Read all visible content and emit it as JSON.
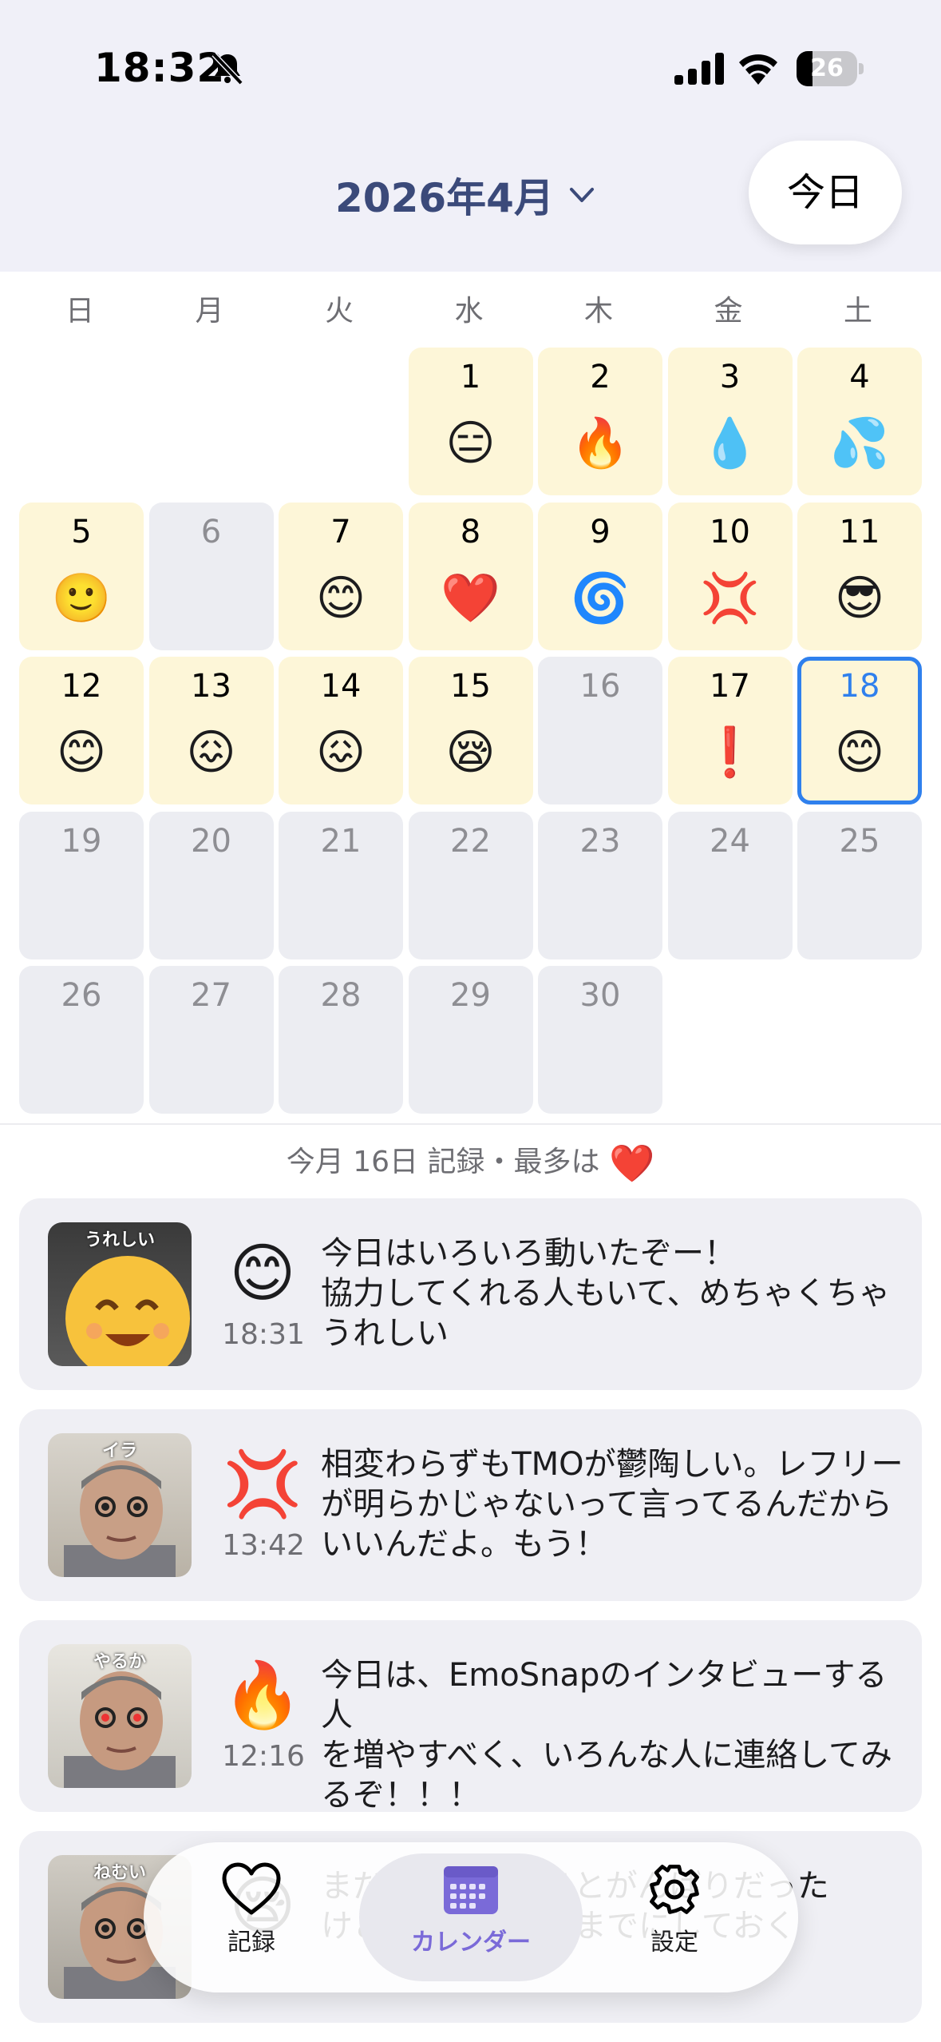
{
  "status_bar": {
    "time": "18:32",
    "battery_level": "26",
    "battery_fraction": 0.26
  },
  "header": {
    "month_title": "2026年4月",
    "today_button": "今日"
  },
  "calendar": {
    "weekdays": [
      "日",
      "月",
      "火",
      "水",
      "木",
      "金",
      "土"
    ],
    "first_weekday_index": 3,
    "today": 18,
    "days": [
      {
        "day": "1",
        "emoji": "😑",
        "recorded": true
      },
      {
        "day": "2",
        "emoji": "🔥",
        "recorded": true
      },
      {
        "day": "3",
        "emoji": "💧",
        "recorded": true
      },
      {
        "day": "4",
        "emoji": "💦",
        "recorded": true
      },
      {
        "day": "5",
        "emoji": "🙂",
        "recorded": true
      },
      {
        "day": "6",
        "emoji": "",
        "recorded": false
      },
      {
        "day": "7",
        "emoji": "😊",
        "recorded": true
      },
      {
        "day": "8",
        "emoji": "❤️",
        "recorded": true
      },
      {
        "day": "9",
        "emoji": "🌀",
        "recorded": true
      },
      {
        "day": "10",
        "emoji": "💢",
        "recorded": true
      },
      {
        "day": "11",
        "emoji": "😎",
        "recorded": true
      },
      {
        "day": "12",
        "emoji": "😊",
        "recorded": true
      },
      {
        "day": "13",
        "emoji": "😖",
        "recorded": true
      },
      {
        "day": "14",
        "emoji": "😖",
        "recorded": true
      },
      {
        "day": "15",
        "emoji": "😪",
        "recorded": true
      },
      {
        "day": "16",
        "emoji": "",
        "recorded": false
      },
      {
        "day": "17",
        "emoji": "❗",
        "recorded": true
      },
      {
        "day": "18",
        "emoji": "😊",
        "recorded": true
      },
      {
        "day": "19",
        "emoji": "",
        "recorded": false
      },
      {
        "day": "20",
        "emoji": "",
        "recorded": false
      },
      {
        "day": "21",
        "emoji": "",
        "recorded": false
      },
      {
        "day": "22",
        "emoji": "",
        "recorded": false
      },
      {
        "day": "23",
        "emoji": "",
        "recorded": false
      },
      {
        "day": "24",
        "emoji": "",
        "recorded": false
      },
      {
        "day": "25",
        "emoji": "",
        "recorded": false
      },
      {
        "day": "26",
        "emoji": "",
        "recorded": false
      },
      {
        "day": "27",
        "emoji": "",
        "recorded": false
      },
      {
        "day": "28",
        "emoji": "",
        "recorded": false
      },
      {
        "day": "29",
        "emoji": "",
        "recorded": false
      },
      {
        "day": "30",
        "emoji": "",
        "recorded": false
      }
    ]
  },
  "summary": {
    "text": "今月 16日 記録・最多は",
    "top_emoji": "❤️"
  },
  "entries": [
    {
      "emoji": "😊",
      "time": "18:31",
      "photo_caption": "うれしい",
      "text": "今日はいろいろ動いたぞー！\n協力してくれる人もいて、めちゃくちゃ\nうれしい"
    },
    {
      "emoji": "💢",
      "time": "13:42",
      "photo_caption": "イラ",
      "text": "相変わらずもTMOが鬱陶しい。レフリー\nが明らかじゃないって言ってるんだから\nいいんだよ。もう！"
    },
    {
      "emoji": "🔥",
      "time": "12:16",
      "photo_caption": "やるか",
      "text": "今日は、EmoSnapのインタビューする人\nを増やすべく、いろんな人に連絡してみ\nるぞ！！！"
    },
    {
      "emoji": "😪",
      "time": "",
      "photo_caption": "ねむい",
      "text": "まだまだ…もうひとがんばりだった\nけど、今日はここまでにしておく"
    }
  ],
  "tabbar": {
    "tabs": [
      {
        "label": "記録",
        "icon": "heart-icon"
      },
      {
        "label": "カレンダー",
        "icon": "calendar-icon"
      },
      {
        "label": "設定",
        "icon": "gear-icon"
      }
    ],
    "active_index": 1
  },
  "colors": {
    "header_bg": "#f0f0f8",
    "recorded_cell": "#fdf6d8",
    "empty_cell": "#ecedf2",
    "today_border": "#2f80ed",
    "month_title": "#3b4a7a",
    "tab_active": "#7a6ad8"
  }
}
